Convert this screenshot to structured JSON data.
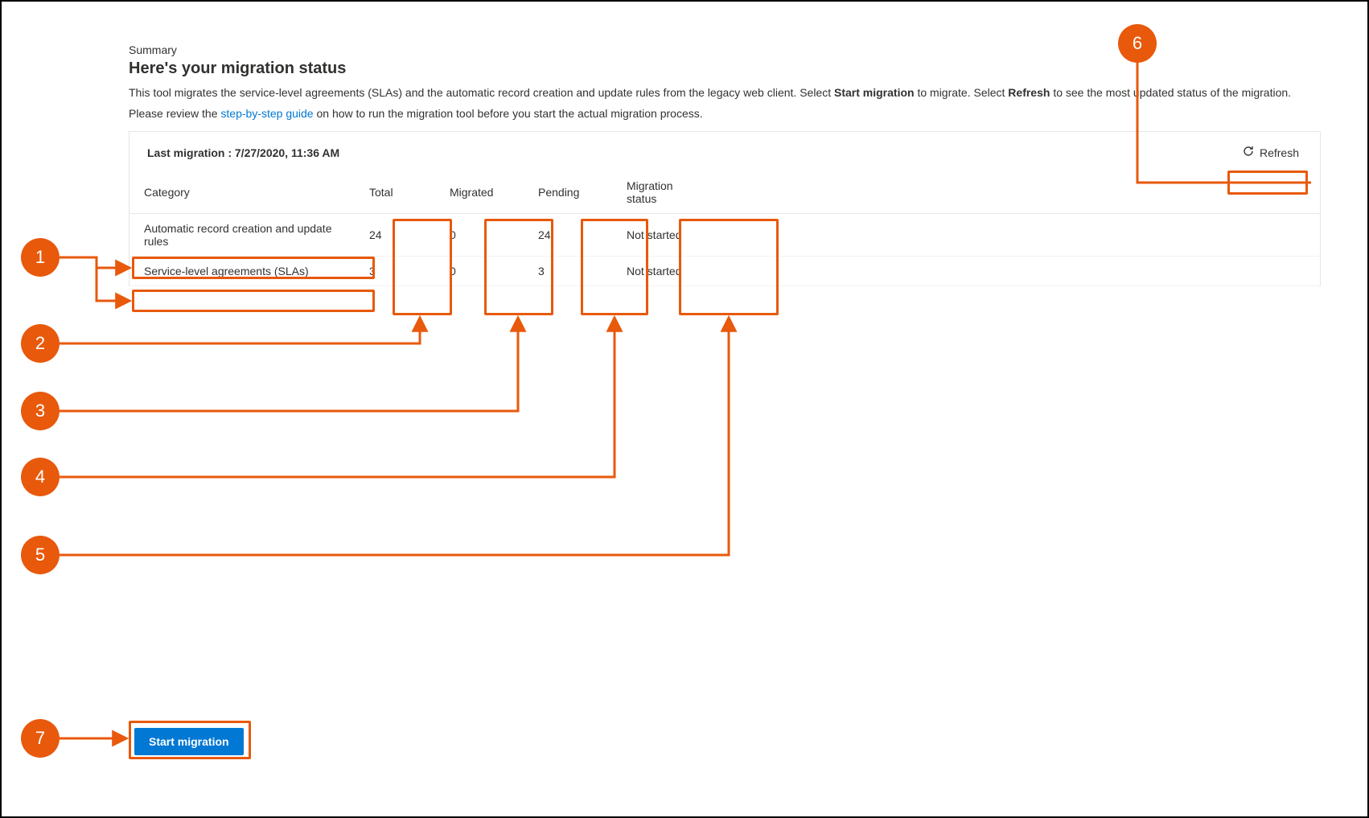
{
  "header": {
    "summary_label": "Summary",
    "title": "Here's your migration status",
    "intro_pre": "This tool migrates the service-level agreements (SLAs) and the automatic record creation and update rules from the legacy web client. Select ",
    "intro_start_bold": "Start migration",
    "intro_mid": " to migrate. Select ",
    "intro_refresh_bold": "Refresh",
    "intro_post": " to see the most updated status of the migration.",
    "guide_pre": "Please review the ",
    "guide_link": "step-by-step guide",
    "guide_post": " on how to run the migration tool before you start the actual migration process."
  },
  "panel": {
    "last_migration_label": "Last migration : 7/27/2020, 11:36 AM",
    "refresh_label": "Refresh"
  },
  "table": {
    "headers": {
      "category": "Category",
      "total": "Total",
      "migrated": "Migrated",
      "pending": "Pending",
      "status": "Migration status"
    },
    "rows": [
      {
        "category": "Automatic record creation and update rules",
        "total": "24",
        "migrated": "0",
        "pending": "24",
        "status": "Not started"
      },
      {
        "category": "Service-level agreements (SLAs)",
        "total": "3",
        "migrated": "0",
        "pending": "3",
        "status": "Not started"
      }
    ]
  },
  "actions": {
    "start_migration": "Start migration"
  },
  "callouts": {
    "c1": "1",
    "c2": "2",
    "c3": "3",
    "c4": "4",
    "c5": "5",
    "c6": "6",
    "c7": "7"
  }
}
